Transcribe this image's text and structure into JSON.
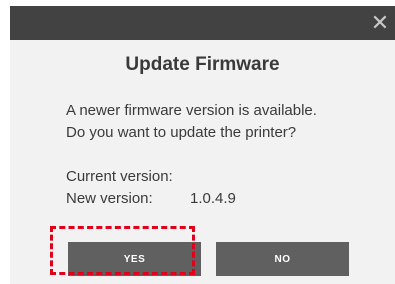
{
  "dialog": {
    "close_glyph": "✕",
    "title": "Update Firmware",
    "message_line1": "A newer firmware version is available.",
    "message_line2": "Do you want to update the printer?",
    "current_version_label": "Current version:",
    "current_version_value": "",
    "new_version_label": "New version:",
    "new_version_value": "1.0.4.9",
    "yes_label": "YES",
    "no_label": "NO"
  },
  "colors": {
    "titlebar": "#424242",
    "dialog_bg": "#f2f2f2",
    "button_bg": "#606060",
    "highlight": "#e0001a"
  }
}
